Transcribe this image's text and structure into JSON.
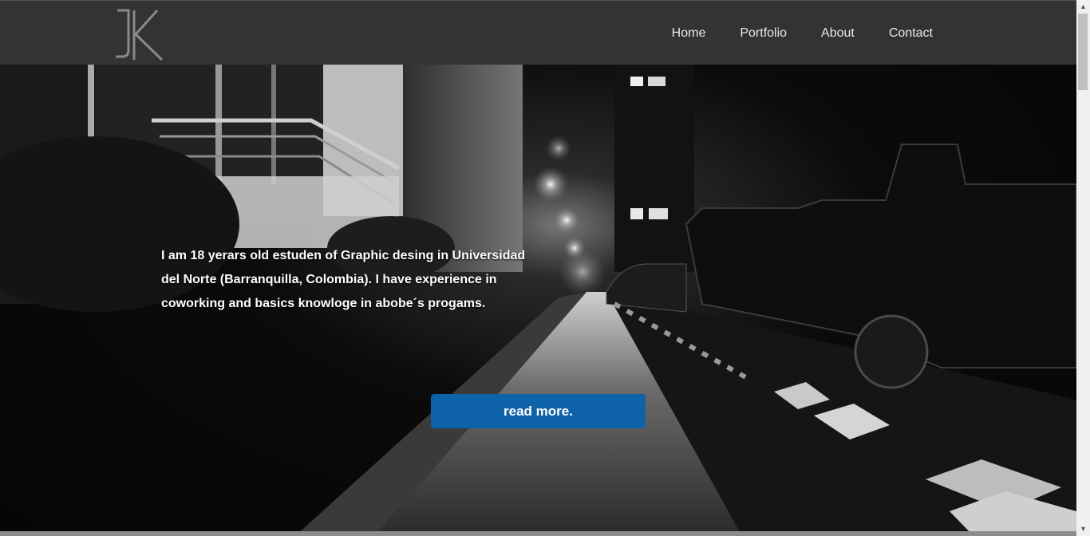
{
  "header": {
    "logo_text": "JK",
    "nav": [
      "Home",
      "Portfolio",
      "About",
      "Contact"
    ]
  },
  "hero": {
    "intro_lines": [
      "I am 18 yerars old estuden of Graphic desing in Universidad",
      "del Norte (Barranquilla, Colombia). I have experience in",
      "coworking and basics knowloge in abobe´s progams."
    ],
    "button_label": "read more."
  },
  "scrollbar": {
    "up_icon": "▲",
    "down_icon": "▼"
  },
  "colors": {
    "navbar": "#333333",
    "button": "#0e62a8"
  }
}
